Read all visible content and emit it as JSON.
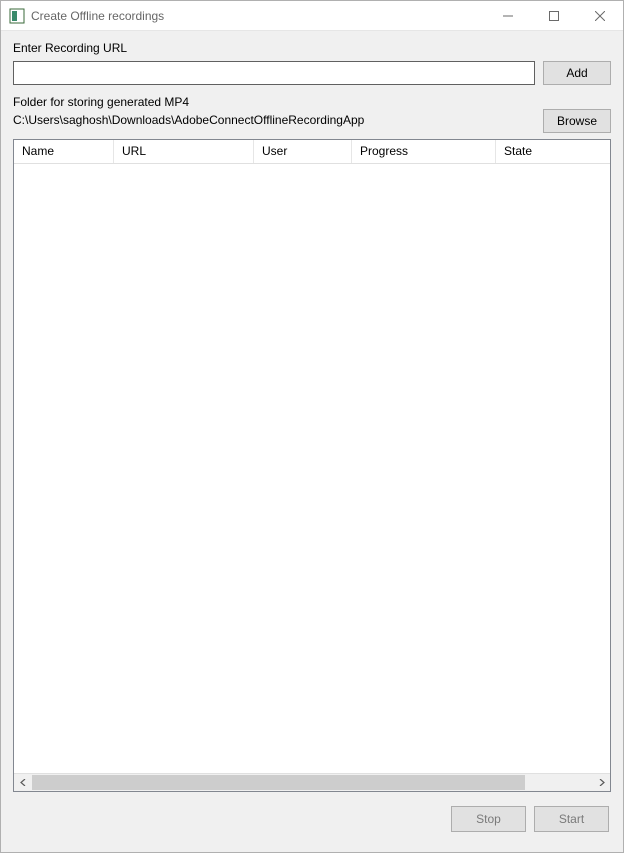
{
  "window": {
    "title": "Create Offline recordings"
  },
  "url_section": {
    "label": "Enter Recording URL",
    "value": "",
    "add_label": "Add"
  },
  "folder_section": {
    "label": "Folder for storing generated MP4",
    "path": "C:\\Users\\saghosh\\Downloads\\AdobeConnectOfflineRecordingApp",
    "browse_label": "Browse"
  },
  "table": {
    "columns": {
      "name": "Name",
      "url": "URL",
      "user": "User",
      "progress": "Progress",
      "state": "State"
    },
    "rows": []
  },
  "footer": {
    "stop_label": "Stop",
    "start_label": "Start"
  }
}
